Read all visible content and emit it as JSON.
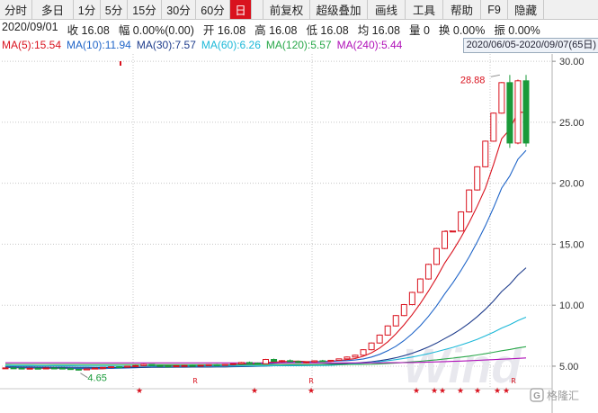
{
  "toolbar": {
    "items": [
      "分时",
      "多日",
      "1分",
      "5分",
      "15分",
      "30分",
      "60分",
      "日",
      "",
      "前复权",
      "超级叠加",
      "画线",
      "工具",
      "帮助",
      "F9",
      "隐藏"
    ],
    "active_index": 7
  },
  "quote": {
    "date": "2020/09/01",
    "close": "收 16.08",
    "change": "幅 0.00%(0.00)",
    "open": "开 16.08",
    "high": "高 16.08",
    "low": "低 16.08",
    "avg": "均 16.08",
    "volume": "量 0",
    "turnover": "换 0.00%",
    "amplitude": "振 0.00%"
  },
  "ma": [
    {
      "label": "MA(5):15.54",
      "color": "#d9121e"
    },
    {
      "label": "MA(10):11.94",
      "color": "#1e64c8"
    },
    {
      "label": "MA(30):7.57",
      "color": "#1e3c8c"
    },
    {
      "label": "MA(60):6.26",
      "color": "#1cb8d8"
    },
    {
      "label": "MA(120):5.57",
      "color": "#2aa84a"
    },
    {
      "label": "MA(240):5.44",
      "color": "#b010b8"
    }
  ],
  "date_range": "2020/06/05-2020/09/07(65日)",
  "chart_data": {
    "type": "candlestick",
    "ylim": [
      3.3,
      30.6
    ],
    "y_ticks": [
      "30.00",
      "25.00",
      "20.00",
      "15.00",
      "10.00",
      "5.00"
    ],
    "y_tick_values": [
      30,
      25,
      20,
      15,
      10,
      5
    ],
    "annotations": {
      "high_label": "28.88",
      "low_label": "4.65",
      "watermark": "Wind",
      "brand": "格隆汇"
    },
    "marker_symbols": [
      "★",
      "R",
      "★",
      "R",
      "★",
      "★",
      "★",
      "★",
      "★",
      "★",
      "★",
      "★",
      "R"
    ],
    "candles": [
      [
        4.85,
        4.88,
        4.82,
        4.86
      ],
      [
        4.86,
        4.9,
        4.83,
        4.84
      ],
      [
        4.84,
        4.87,
        4.8,
        4.81
      ],
      [
        4.81,
        4.85,
        4.79,
        4.83
      ],
      [
        4.83,
        4.86,
        4.8,
        4.82
      ],
      [
        4.82,
        4.88,
        4.8,
        4.85
      ],
      [
        4.85,
        4.9,
        4.82,
        4.84
      ],
      [
        4.84,
        4.87,
        4.78,
        4.8
      ],
      [
        4.8,
        4.84,
        4.72,
        4.75
      ],
      [
        4.75,
        4.78,
        4.65,
        4.7
      ],
      [
        4.7,
        4.8,
        4.68,
        4.78
      ],
      [
        4.78,
        4.86,
        4.76,
        4.84
      ],
      [
        4.84,
        4.92,
        4.82,
        4.9
      ],
      [
        4.9,
        4.98,
        4.86,
        4.95
      ],
      [
        4.95,
        5.0,
        4.88,
        4.92
      ],
      [
        4.92,
        5.02,
        4.9,
        5.0
      ],
      [
        5.0,
        5.1,
        4.95,
        5.05
      ],
      [
        5.05,
        5.2,
        5.0,
        5.15
      ],
      [
        5.15,
        5.18,
        5.02,
        5.05
      ],
      [
        5.05,
        5.1,
        4.98,
        5.02
      ],
      [
        5.02,
        5.08,
        4.96,
        5.0
      ],
      [
        5.0,
        5.06,
        4.95,
        5.04
      ],
      [
        5.04,
        5.1,
        5.0,
        5.06
      ],
      [
        5.06,
        5.12,
        5.02,
        5.05
      ],
      [
        5.05,
        5.1,
        5.0,
        5.08
      ],
      [
        5.08,
        5.15,
        5.04,
        5.12
      ],
      [
        5.12,
        5.18,
        5.06,
        5.1
      ],
      [
        5.1,
        5.16,
        5.05,
        5.14
      ],
      [
        5.14,
        5.22,
        5.1,
        5.2
      ],
      [
        5.2,
        5.35,
        5.15,
        5.3
      ],
      [
        5.3,
        5.38,
        5.2,
        5.25
      ],
      [
        5.25,
        5.3,
        5.15,
        5.2
      ],
      [
        5.2,
        5.6,
        5.18,
        5.55
      ],
      [
        5.55,
        5.62,
        5.35,
        5.4
      ],
      [
        5.4,
        5.5,
        5.3,
        5.45
      ],
      [
        5.45,
        5.55,
        5.35,
        5.38
      ],
      [
        5.38,
        5.45,
        5.25,
        5.3
      ],
      [
        5.3,
        5.4,
        5.22,
        5.35
      ],
      [
        5.35,
        5.48,
        5.3,
        5.44
      ],
      [
        5.44,
        5.52,
        5.36,
        5.4
      ],
      [
        5.4,
        5.5,
        5.35,
        5.48
      ],
      [
        5.48,
        5.62,
        5.45,
        5.6
      ],
      [
        5.6,
        5.8,
        5.55,
        5.75
      ],
      [
        5.75,
        5.95,
        5.7,
        5.9
      ],
      [
        5.9,
        6.4,
        5.85,
        6.35
      ],
      [
        6.35,
        6.95,
        6.3,
        6.9
      ],
      [
        6.9,
        7.6,
        6.85,
        7.55
      ],
      [
        7.55,
        8.35,
        7.5,
        8.3
      ],
      [
        8.3,
        9.2,
        8.25,
        9.15
      ],
      [
        9.15,
        10.1,
        9.1,
        10.05
      ],
      [
        10.05,
        11.1,
        10.0,
        11.05
      ],
      [
        11.05,
        12.2,
        11.0,
        12.15
      ],
      [
        12.15,
        13.4,
        12.1,
        13.35
      ],
      [
        13.35,
        14.7,
        13.3,
        14.65
      ],
      [
        14.65,
        16.1,
        14.6,
        16.05
      ],
      [
        16.08,
        16.08,
        16.08,
        16.08
      ],
      [
        16.08,
        17.7,
        16.05,
        17.65
      ],
      [
        17.65,
        19.5,
        17.6,
        19.45
      ],
      [
        19.45,
        21.4,
        19.4,
        21.35
      ],
      [
        21.35,
        23.5,
        21.3,
        23.45
      ],
      [
        23.45,
        25.8,
        23.4,
        25.75
      ],
      [
        25.75,
        28.3,
        25.7,
        28.25
      ],
      [
        28.25,
        28.88,
        22.9,
        23.3
      ],
      [
        23.3,
        28.5,
        23.2,
        28.4
      ],
      [
        28.4,
        28.88,
        23.0,
        23.3
      ]
    ]
  }
}
